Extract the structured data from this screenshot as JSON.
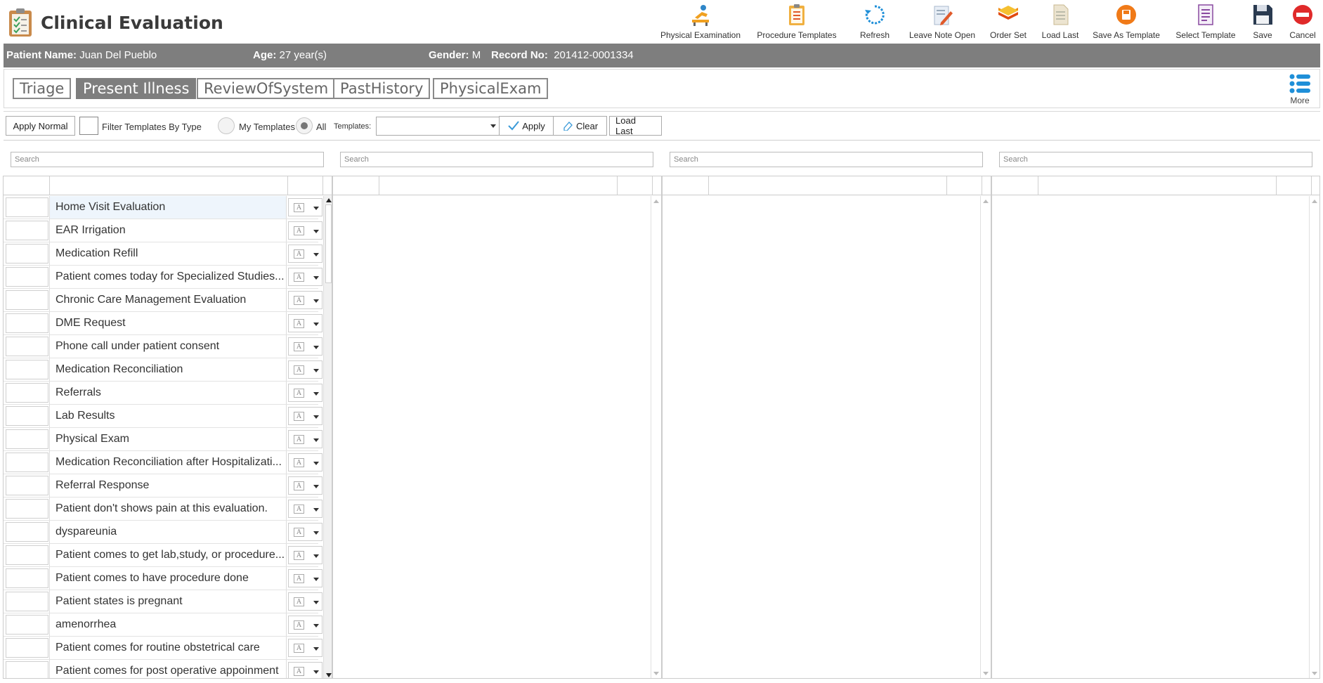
{
  "app": {
    "title": "Clinical Evaluation",
    "icon": "clipboard-icon"
  },
  "toolbar": [
    {
      "label": "Physical Examination",
      "icon": "physical-exam-icon"
    },
    {
      "label": "Procedure Templates",
      "icon": "procedure-clipboard-icon"
    },
    {
      "label": "Refresh",
      "icon": "refresh-icon"
    },
    {
      "label": "Leave Note Open",
      "icon": "note-pencil-icon"
    },
    {
      "label": "Order Set",
      "icon": "layers-icon"
    },
    {
      "label": "Load Last",
      "icon": "document-icon"
    },
    {
      "label": "Save As Template",
      "icon": "save-as-template-icon"
    },
    {
      "label": "Select Template",
      "icon": "select-template-icon"
    },
    {
      "label": "Save",
      "icon": "floppy-disk-icon"
    },
    {
      "label": "Cancel",
      "icon": "cancel-icon"
    }
  ],
  "patient": {
    "name_label": "Patient Name:",
    "name": "Juan Del Pueblo",
    "age_label": "Age:",
    "age": "27 year(s)",
    "gender_label": "Gender:",
    "gender": "M",
    "record_label": "Record No:",
    "record": "201412-0001334"
  },
  "tabs": [
    {
      "label": "Triage",
      "active": false
    },
    {
      "label": "Present Illness",
      "active": true
    },
    {
      "label": "ReviewOfSystem",
      "active": false
    },
    {
      "label": "PastHistory",
      "active": false
    },
    {
      "label": "PhysicalExam",
      "active": false
    }
  ],
  "more": {
    "label": "More",
    "icon": "list-icon"
  },
  "filter": {
    "apply_normal": "Apply Normal",
    "filter_by_type": "Filter Templates By Type",
    "my_templates": "My Templates",
    "all": "All",
    "selected_scope": "All",
    "templates_label": "Templates:",
    "templates_value": "",
    "apply": "Apply",
    "clear": "Clear",
    "load_last": "Load Last"
  },
  "search_placeholder": "Search",
  "templates": [
    "Home Visit Evaluation",
    "EAR Irrigation",
    "Medication Refill",
    "Patient comes today for Specialized Studies...",
    "Chronic Care Management Evaluation",
    "DME Request",
    "Phone call under patient consent",
    "Medication Reconciliation",
    "Referrals",
    "Lab Results",
    "Physical Exam",
    "Medication Reconciliation after Hospitalizati...",
    "Referral Response",
    "Patient don't shows pain at this evaluation.",
    "dyspareunia",
    "Patient comes to get lab,study, or procedure...",
    "Patient comes to have procedure done",
    "Patient states is pregnant",
    "amenorrhea",
    "Patient comes for routine obstetrical care",
    "Patient comes for post operative appoinment"
  ]
}
